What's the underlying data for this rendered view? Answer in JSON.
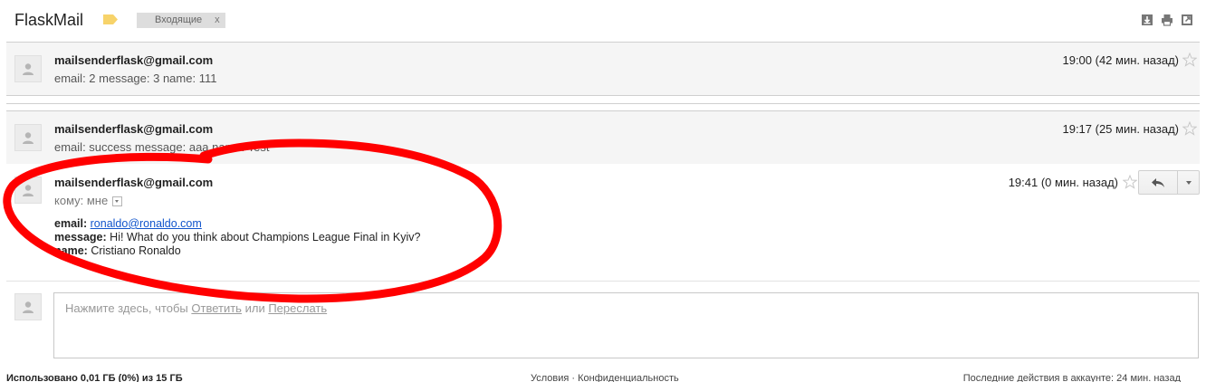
{
  "header": {
    "subject": "FlaskMail",
    "label_chip": "Входящие",
    "label_chip_remove": "x",
    "label_color": "#f7d36a",
    "icons": [
      "download-icon",
      "print-icon",
      "new-window-icon"
    ]
  },
  "messages": [
    {
      "state": "collapsed",
      "sender": "mailsenderflask@gmail.com",
      "snippet": "email: 2 message: 3 name: 111",
      "time": "19:00 (42 мин. назад)",
      "starred": false
    },
    {
      "state": "collapsed",
      "sender": "mailsenderflask@gmail.com",
      "snippet": "email: success message: aaa name: Test",
      "time": "19:17 (25 мин. назад)",
      "starred": false
    },
    {
      "state": "expanded",
      "sender": "mailsenderflask@gmail.com",
      "to_line": "кому: мне",
      "time": "19:41 (0 мин. назад)",
      "starred": false,
      "body": {
        "email_label": "email:",
        "email_value": "ronaldo@ronaldo.com",
        "message_label": "message:",
        "message_value": "Hi! What do you think about Champions League Final in Kyiv?",
        "name_label": "name:",
        "name_value": "Cristiano Ronaldo"
      }
    }
  ],
  "reply_box": {
    "hint_prefix": "Нажмите здесь, чтобы",
    "reply_link": "Ответить",
    "or_text": "или",
    "forward_link": "Переслать"
  },
  "footer": {
    "storage": "Использовано 0,01 ГБ (0%) из 15 ГБ",
    "links": "Условия · Конфиденциальность",
    "activity": "Последние действия в аккаунте: 24 мин. назад"
  },
  "colors": {
    "annotation_red": "#ff0000",
    "link_blue": "#1155cc"
  }
}
